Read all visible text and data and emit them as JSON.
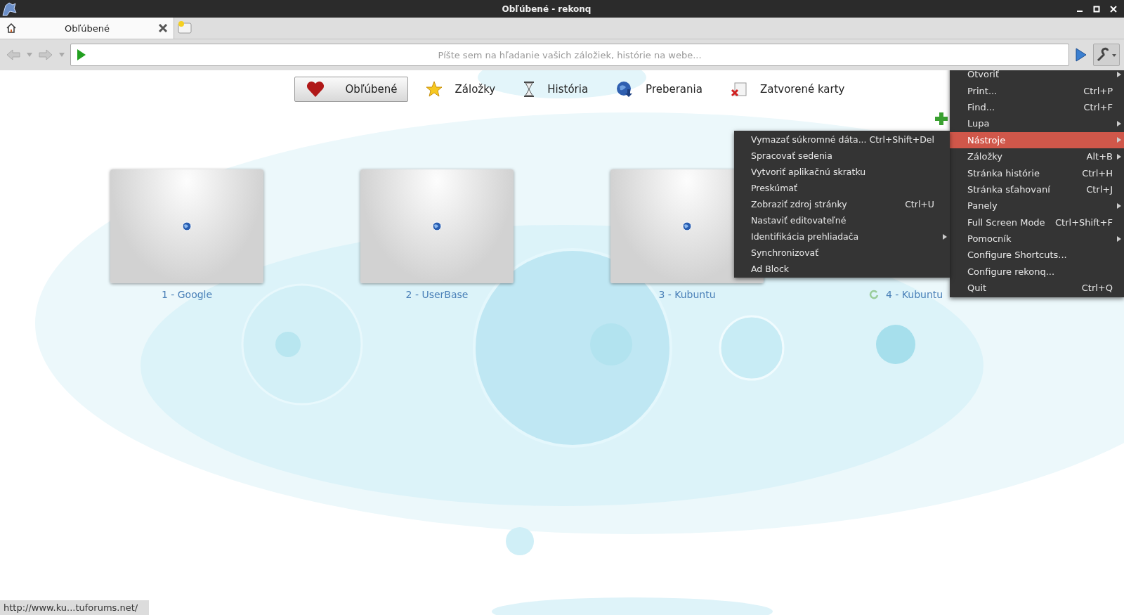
{
  "window": {
    "title": "Obľúbené - rekonq"
  },
  "tabs": [
    {
      "label": "Obľúbené",
      "selected": true
    }
  ],
  "location": {
    "placeholder": "Píšte sem na hľadanie vašich záložiek, histórie na webe..."
  },
  "nav": [
    {
      "label": "Obľúbené",
      "kind": "heart",
      "selected": true
    },
    {
      "label": "Záložky",
      "kind": "star",
      "selected": false
    },
    {
      "label": "História",
      "kind": "hourglass",
      "selected": false
    },
    {
      "label": "Preberania",
      "kind": "download",
      "selected": false
    },
    {
      "label": "Zatvorené karty",
      "kind": "closed",
      "selected": false
    }
  ],
  "thumbnails": [
    {
      "label": "1 - Google",
      "kind": "preview"
    },
    {
      "label": "2 - UserBase",
      "kind": "preview"
    },
    {
      "label": "3 - Kubuntu",
      "kind": "preview"
    },
    {
      "label": "4 - Kubuntu",
      "kind": "loading"
    }
  ],
  "menu": [
    {
      "kind": "item",
      "label": "Otvoriť",
      "submenu": true,
      "selected": false
    },
    {
      "kind": "item",
      "label": "Print...",
      "shortcut": "Ctrl+P",
      "submenu": false,
      "selected": false
    },
    {
      "kind": "item",
      "label": "Find...",
      "shortcut": "Ctrl+F",
      "submenu": false,
      "selected": false
    },
    {
      "kind": "item",
      "label": "Lupa",
      "submenu": true,
      "selected": false
    },
    {
      "kind": "item",
      "label": "Nástroje",
      "submenu": true,
      "selected": true
    },
    {
      "kind": "item",
      "label": "Záložky",
      "shortcut": "Alt+B",
      "submenu": true,
      "selected": false
    },
    {
      "kind": "item",
      "label": "Stránka histórie",
      "shortcut": "Ctrl+H",
      "submenu": false,
      "selected": false
    },
    {
      "kind": "item",
      "label": "Stránka sťahovaní",
      "shortcut": "Ctrl+J",
      "submenu": false,
      "selected": false
    },
    {
      "kind": "item",
      "label": "Panely",
      "submenu": true,
      "selected": false
    },
    {
      "kind": "item",
      "label": "Full Screen Mode",
      "shortcut": "Ctrl+Shift+F",
      "submenu": false,
      "selected": false
    },
    {
      "kind": "item",
      "label": "Pomocník",
      "submenu": true,
      "selected": false
    },
    {
      "kind": "item",
      "label": "Configure Shortcuts...",
      "submenu": false,
      "selected": false
    },
    {
      "kind": "item",
      "label": "Configure rekonq...",
      "submenu": false,
      "selected": false
    },
    {
      "kind": "item",
      "label": "Quit",
      "shortcut": "Ctrl+Q",
      "submenu": false,
      "selected": false
    }
  ],
  "submenu": [
    {
      "label": "Vymazať súkromné dáta...",
      "shortcut": "Ctrl+Shift+Del",
      "submenu": false
    },
    {
      "label": "Spracovať sedenia",
      "submenu": false
    },
    {
      "label": "Vytvoriť aplikačnú skratku",
      "submenu": false
    },
    {
      "label": "Preskúmať",
      "submenu": false
    },
    {
      "label": "Zobraziť zdroj stránky",
      "shortcut": "Ctrl+U",
      "submenu": false
    },
    {
      "label": "Nastaviť editovateľné",
      "submenu": false
    },
    {
      "label": "Identifikácia prehliadača",
      "submenu": true
    },
    {
      "label": "Synchronizovať",
      "submenu": false
    },
    {
      "label": "Ad Block",
      "submenu": false
    }
  ],
  "status_bar": {
    "url": "http://www.ku...tuforums.net/"
  }
}
